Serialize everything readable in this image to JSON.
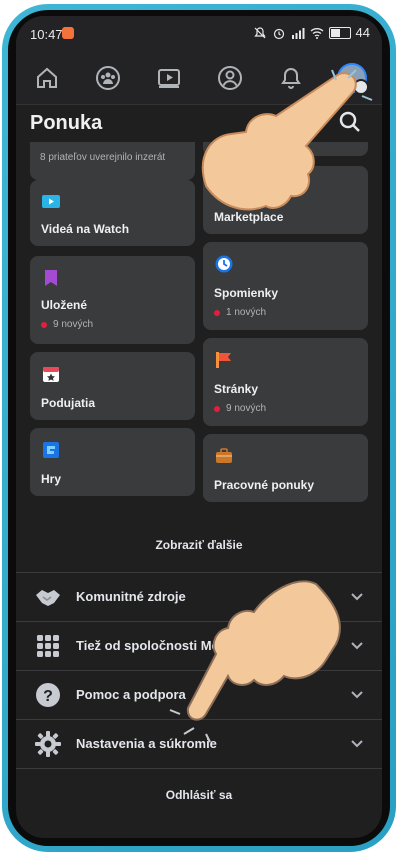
{
  "status": {
    "time": "10:47",
    "battery": "44"
  },
  "header": {
    "title": "Ponuka"
  },
  "partial_card_text": "8 priateľov uverejnilo inzerát",
  "cards": [
    {
      "label": "Videá na Watch",
      "icon": "watch-icon",
      "badge": ""
    },
    {
      "label": "Marketplace",
      "icon": "marketplace-icon",
      "badge": ""
    },
    {
      "label": "Uložené",
      "icon": "saved-icon",
      "badge": "9 nových"
    },
    {
      "label": "Spomienky",
      "icon": "memories-icon",
      "badge": "1 nových"
    },
    {
      "label": "Podujatia",
      "icon": "events-icon",
      "badge": ""
    },
    {
      "label": "Stránky",
      "icon": "pages-icon",
      "badge": "9 nových"
    },
    {
      "label": "Hry",
      "icon": "games-icon",
      "badge": ""
    },
    {
      "label": "Pracovné ponuky",
      "icon": "jobs-icon",
      "badge": ""
    }
  ],
  "see_more": "Zobraziť ďalšie",
  "sections": [
    {
      "label": "Komunitné zdroje",
      "icon": "handshake-icon"
    },
    {
      "label": "Tiež od spoločnosti Meta",
      "icon": "grid-icon"
    },
    {
      "label": "Pomoc a podpora",
      "icon": "help-icon"
    },
    {
      "label": "Nastavenia a súkromie",
      "icon": "gear-icon"
    }
  ],
  "logout": "Odhlásiť sa",
  "colors": {
    "accent": "#2d88ff",
    "notification_dot": "#e41e3f",
    "card_bg": "#3a3b3c",
    "screen_bg": "#1f1f20"
  }
}
